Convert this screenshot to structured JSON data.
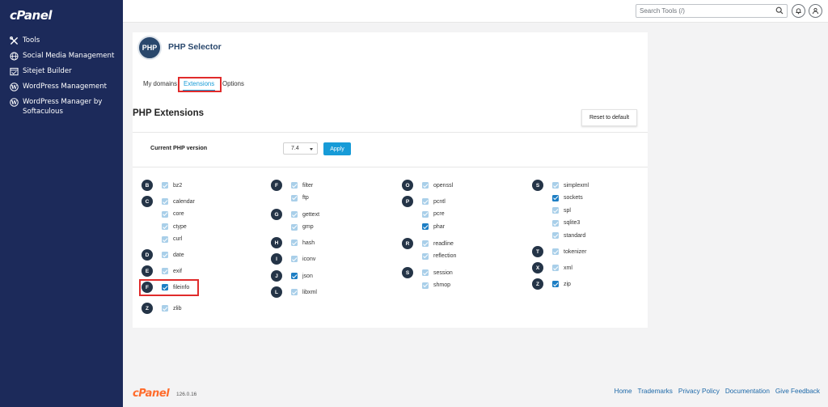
{
  "brand": {
    "logo": "cPanel"
  },
  "sidebar": {
    "items": [
      {
        "label": "Tools",
        "icon": "tools-icon"
      },
      {
        "label": "Social Media Management",
        "icon": "globe-icon"
      },
      {
        "label": "Sitejet Builder",
        "icon": "sitejet-icon"
      },
      {
        "label": "WordPress Management",
        "icon": "wordpress-icon"
      },
      {
        "label": "WordPress Manager by Softaculous",
        "icon": "wordpress-icon"
      }
    ]
  },
  "topbar": {
    "search_placeholder": "Search Tools (/)",
    "icons": [
      "search-icon",
      "bell-icon",
      "user-icon"
    ]
  },
  "page": {
    "app_badge": "PHP",
    "title": "PHP Selector",
    "tabs": [
      {
        "label": "My domains",
        "active": false
      },
      {
        "label": "Extensions",
        "active": true
      },
      {
        "label": "Options",
        "active": false
      }
    ],
    "section_title": "PHP Extensions",
    "reset_label": "Reset to default",
    "version_label": "Current PHP version",
    "version_value": "7.4",
    "apply_label": "Apply"
  },
  "colors": {
    "sidebar": "#1c2a5a",
    "accent": "#179bd7",
    "highlight": "#e02b2b",
    "footer_logo": "#ff6c2c"
  },
  "extensions": {
    "columns": [
      {
        "groups": [
          {
            "letter": "B",
            "items": [
              {
                "name": "bz2",
                "checked": false
              }
            ]
          },
          {
            "letter": "C",
            "items": [
              {
                "name": "calendar",
                "checked": false
              },
              {
                "name": "core",
                "checked": false
              },
              {
                "name": "ctype",
                "checked": false
              },
              {
                "name": "curl",
                "checked": false
              }
            ]
          },
          {
            "letter": "D",
            "items": [
              {
                "name": "date",
                "checked": false
              }
            ]
          },
          {
            "letter": "E",
            "items": [
              {
                "name": "exif",
                "checked": false
              }
            ]
          },
          {
            "letter": "F",
            "items": [
              {
                "name": "fileinfo",
                "checked": true,
                "highlighted": true
              }
            ]
          },
          {
            "letter": "Z",
            "items": [
              {
                "name": "zlib",
                "checked": false
              }
            ]
          }
        ]
      },
      {
        "groups": [
          {
            "letter": "F",
            "items": [
              {
                "name": "filter",
                "checked": false
              },
              {
                "name": "ftp",
                "checked": false
              }
            ]
          },
          {
            "letter": "G",
            "items": [
              {
                "name": "gettext",
                "checked": false
              },
              {
                "name": "gmp",
                "checked": false
              }
            ]
          },
          {
            "letter": "H",
            "items": [
              {
                "name": "hash",
                "checked": false
              }
            ]
          },
          {
            "letter": "I",
            "items": [
              {
                "name": "iconv",
                "checked": false
              }
            ]
          },
          {
            "letter": "J",
            "items": [
              {
                "name": "json",
                "checked": true
              }
            ]
          },
          {
            "letter": "L",
            "items": [
              {
                "name": "libxml",
                "checked": false
              }
            ]
          }
        ]
      },
      {
        "groups": [
          {
            "letter": "O",
            "items": [
              {
                "name": "openssl",
                "checked": false
              }
            ]
          },
          {
            "letter": "P",
            "items": [
              {
                "name": "pcntl",
                "checked": false
              },
              {
                "name": "pcre",
                "checked": false
              },
              {
                "name": "phar",
                "checked": true
              }
            ]
          },
          {
            "letter": "R",
            "items": [
              {
                "name": "readline",
                "checked": false
              },
              {
                "name": "reflection",
                "checked": false
              }
            ]
          },
          {
            "letter": "S",
            "items": [
              {
                "name": "session",
                "checked": false
              },
              {
                "name": "shmop",
                "checked": false
              }
            ]
          }
        ]
      },
      {
        "groups": [
          {
            "letter": "S",
            "items": [
              {
                "name": "simplexml",
                "checked": false
              },
              {
                "name": "sockets",
                "checked": true
              },
              {
                "name": "spl",
                "checked": false
              },
              {
                "name": "sqlite3",
                "checked": false
              },
              {
                "name": "standard",
                "checked": false
              }
            ]
          },
          {
            "letter": "T",
            "items": [
              {
                "name": "tokenizer",
                "checked": false
              }
            ]
          },
          {
            "letter": "X",
            "items": [
              {
                "name": "xml",
                "checked": false
              }
            ]
          },
          {
            "letter": "Z",
            "items": [
              {
                "name": "zip",
                "checked": true
              }
            ]
          }
        ]
      }
    ]
  },
  "footer": {
    "logo": "cPanel",
    "version": "126.0.16",
    "links": [
      "Home",
      "Trademarks",
      "Privacy Policy",
      "Documentation",
      "Give Feedback"
    ]
  }
}
